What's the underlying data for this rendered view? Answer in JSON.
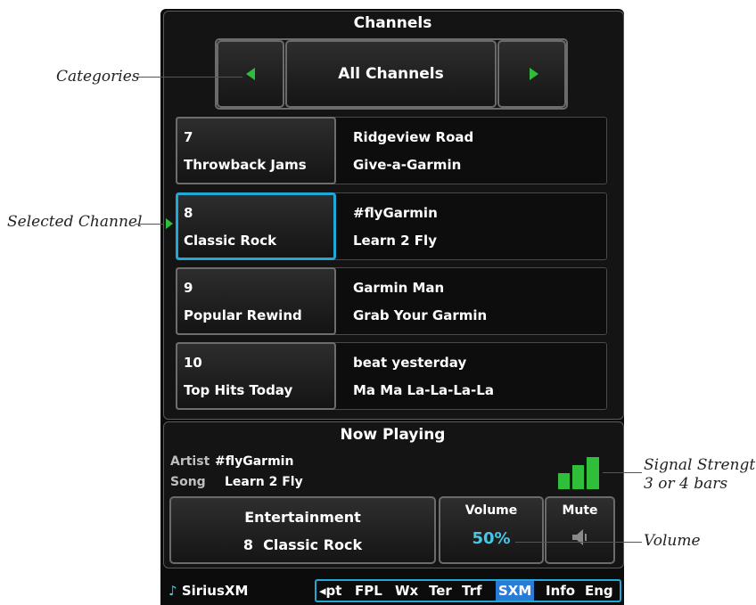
{
  "channels": {
    "title": "Channels",
    "category": "All Channels",
    "rows": [
      {
        "number": "7",
        "name": "Throwback Jams",
        "artist": "Ridgeview Road",
        "song": "Give-a-Garmin"
      },
      {
        "number": "8",
        "name": "Classic Rock",
        "artist": "#flyGarmin",
        "song": "Learn 2 Fly"
      },
      {
        "number": "9",
        "name": "Popular Rewind",
        "artist": "Garmin Man",
        "song": "Grab Your Garmin"
      },
      {
        "number": "10",
        "name": "Top Hits Today",
        "artist": "beat yesterday",
        "song": "Ma Ma La-La-La-La"
      }
    ]
  },
  "now_playing": {
    "title": "Now Playing",
    "artist_label": "Artist",
    "artist_value": "#flyGarmin",
    "song_label": "Song",
    "song_value": "Learn 2 Fly",
    "category_label": "Entertainment",
    "channel_label": "8  Classic Rock",
    "volume_label": "Volume",
    "volume_value": "50%",
    "mute_label": "Mute",
    "signal_bars": 3
  },
  "bottom_bar": {
    "source_label": "SiriusXM",
    "tabs": [
      "◂pt",
      "FPL",
      "Wx",
      "Ter",
      "Trf",
      "SXM",
      "Info",
      "Eng"
    ],
    "active_tab": "SXM"
  },
  "callouts": {
    "categories": "Categories",
    "selected_channel": "Selected Channel",
    "signal_strength_1": "Signal Strength",
    "signal_strength_2": "3 or 4 bars",
    "volume": "Volume"
  },
  "colors": {
    "accent_green": "#2fbf3a",
    "selected_cyan": "#1fa8d8",
    "volume_cyan": "#45c8e8",
    "active_tab_bg": "#2a7bd6"
  }
}
